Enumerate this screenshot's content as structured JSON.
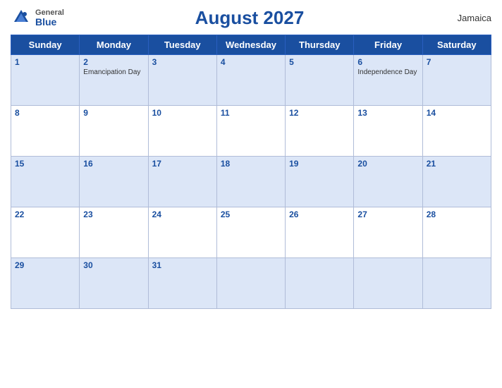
{
  "header": {
    "logo_general": "General",
    "logo_blue": "Blue",
    "title": "August 2027",
    "country": "Jamaica"
  },
  "days_of_week": [
    "Sunday",
    "Monday",
    "Tuesday",
    "Wednesday",
    "Thursday",
    "Friday",
    "Saturday"
  ],
  "weeks": [
    [
      {
        "num": "1",
        "blue": true,
        "event": ""
      },
      {
        "num": "2",
        "blue": true,
        "event": "Emancipation Day"
      },
      {
        "num": "3",
        "blue": true,
        "event": ""
      },
      {
        "num": "4",
        "blue": true,
        "event": ""
      },
      {
        "num": "5",
        "blue": true,
        "event": ""
      },
      {
        "num": "6",
        "blue": true,
        "event": "Independence Day"
      },
      {
        "num": "7",
        "blue": true,
        "event": ""
      }
    ],
    [
      {
        "num": "8",
        "blue": false,
        "event": ""
      },
      {
        "num": "9",
        "blue": false,
        "event": ""
      },
      {
        "num": "10",
        "blue": false,
        "event": ""
      },
      {
        "num": "11",
        "blue": false,
        "event": ""
      },
      {
        "num": "12",
        "blue": false,
        "event": ""
      },
      {
        "num": "13",
        "blue": false,
        "event": ""
      },
      {
        "num": "14",
        "blue": false,
        "event": ""
      }
    ],
    [
      {
        "num": "15",
        "blue": true,
        "event": ""
      },
      {
        "num": "16",
        "blue": true,
        "event": ""
      },
      {
        "num": "17",
        "blue": true,
        "event": ""
      },
      {
        "num": "18",
        "blue": true,
        "event": ""
      },
      {
        "num": "19",
        "blue": true,
        "event": ""
      },
      {
        "num": "20",
        "blue": true,
        "event": ""
      },
      {
        "num": "21",
        "blue": true,
        "event": ""
      }
    ],
    [
      {
        "num": "22",
        "blue": false,
        "event": ""
      },
      {
        "num": "23",
        "blue": false,
        "event": ""
      },
      {
        "num": "24",
        "blue": false,
        "event": ""
      },
      {
        "num": "25",
        "blue": false,
        "event": ""
      },
      {
        "num": "26",
        "blue": false,
        "event": ""
      },
      {
        "num": "27",
        "blue": false,
        "event": ""
      },
      {
        "num": "28",
        "blue": false,
        "event": ""
      }
    ],
    [
      {
        "num": "29",
        "blue": true,
        "event": ""
      },
      {
        "num": "30",
        "blue": true,
        "event": ""
      },
      {
        "num": "31",
        "blue": true,
        "event": ""
      },
      {
        "num": "",
        "blue": true,
        "event": ""
      },
      {
        "num": "",
        "blue": true,
        "event": ""
      },
      {
        "num": "",
        "blue": true,
        "event": ""
      },
      {
        "num": "",
        "blue": true,
        "event": ""
      }
    ]
  ]
}
